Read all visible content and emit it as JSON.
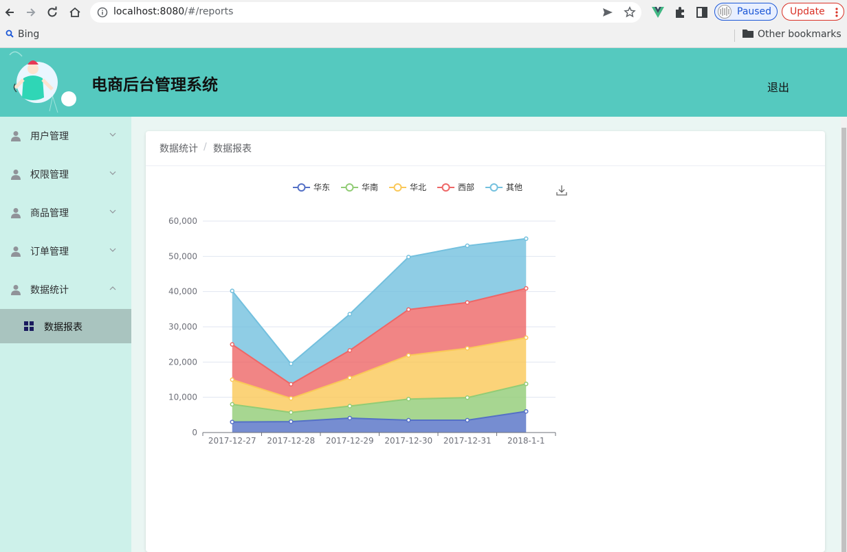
{
  "browser": {
    "url_host": "localhost:8080",
    "url_path": "/#/reports",
    "paused_label": "Paused",
    "update_label": "Update",
    "bookmark_bing": "Bing",
    "bookmark_other": "Other bookmarks"
  },
  "header": {
    "title": "电商后台管理系统",
    "logout": "退出"
  },
  "sidebar": {
    "items": [
      {
        "label": "用户管理",
        "icon": "user-icon",
        "expanded": false
      },
      {
        "label": "权限管理",
        "icon": "user-icon",
        "expanded": false
      },
      {
        "label": "商品管理",
        "icon": "user-icon",
        "expanded": false
      },
      {
        "label": "订单管理",
        "icon": "user-icon",
        "expanded": false
      },
      {
        "label": "数据统计",
        "icon": "user-icon",
        "expanded": true
      }
    ],
    "subitem": {
      "label": "数据报表",
      "icon": "grid-icon",
      "active": true
    }
  },
  "breadcrumb": [
    "数据统计",
    "数据报表"
  ],
  "colors": {
    "header": "#55c9bf",
    "sidebar": "#cdf1ea",
    "active_submenu": "#a9c4bf"
  },
  "chart_data": {
    "type": "area",
    "stacked": true,
    "x": [
      "2017-12-27",
      "2017-12-28",
      "2017-12-29",
      "2017-12-30",
      "2017-12-31",
      "2018-1-1"
    ],
    "series": [
      {
        "name": "华东",
        "color": "#5470c6",
        "values": [
          3000,
          3100,
          4100,
          3500,
          3500,
          6000
        ]
      },
      {
        "name": "华南",
        "color": "#91cc75",
        "values": [
          5000,
          2600,
          3400,
          6000,
          6400,
          7800
        ]
      },
      {
        "name": "华北",
        "color": "#fac858",
        "values": [
          7000,
          4000,
          8000,
          12400,
          14000,
          13100
        ]
      },
      {
        "name": "西部",
        "color": "#ee6666",
        "values": [
          10000,
          4000,
          7800,
          13000,
          13000,
          14000
        ]
      },
      {
        "name": "其他",
        "color": "#73c0de",
        "values": [
          15200,
          5800,
          10300,
          14900,
          16100,
          14100
        ]
      }
    ],
    "yticks": [
      "0",
      "10,000",
      "20,000",
      "30,000",
      "40,000",
      "50,000",
      "60,000"
    ],
    "ylim": [
      0,
      60000
    ],
    "legend_position": "top",
    "grid": true,
    "toolbox": "save-as-image"
  }
}
